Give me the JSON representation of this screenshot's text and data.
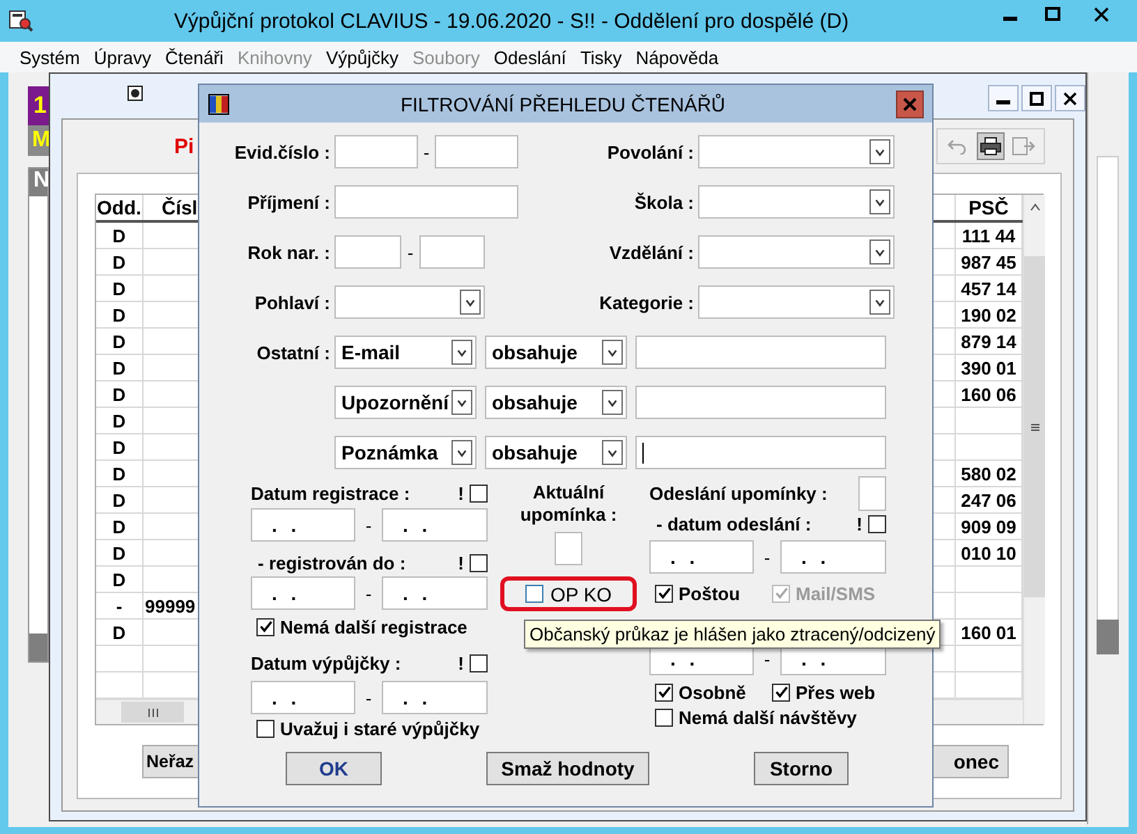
{
  "window": {
    "title": "Výpůjční protokol CLAVIUS - 19.06.2020 - S!! - Oddělení pro dospělé (D)"
  },
  "menu": [
    {
      "label": "Systém",
      "disabled": false
    },
    {
      "label": "Úpravy",
      "disabled": false
    },
    {
      "label": "Čtenáři",
      "disabled": false
    },
    {
      "label": "Knihovny",
      "disabled": true
    },
    {
      "label": "Výpůjčky",
      "disabled": false
    },
    {
      "label": "Soubory",
      "disabled": true
    },
    {
      "label": "Odeslání",
      "disabled": false
    },
    {
      "label": "Tisky",
      "disabled": false
    },
    {
      "label": "Nápověda",
      "disabled": false
    }
  ],
  "side_window": {
    "badge": "1",
    "label": "M",
    "column_1": "N"
  },
  "list_window": {
    "heading": "Pi",
    "toolbar": [
      {
        "kind": "undo",
        "disabled": true
      },
      {
        "kind": "print",
        "disabled": false
      },
      {
        "kind": "export",
        "disabled": true
      }
    ],
    "table": {
      "columns": [
        "Odd.",
        "Čísl",
        "PSČ"
      ],
      "rows": [
        {
          "odd": "D",
          "psc": "111 44"
        },
        {
          "odd": "D",
          "psc": "987 45"
        },
        {
          "odd": "D",
          "psc": "457 14"
        },
        {
          "odd": "D",
          "psc": "190 02"
        },
        {
          "odd": "D",
          "psc": "879 14"
        },
        {
          "odd": "D",
          "psc": "390 01"
        },
        {
          "odd": "D",
          "psc": "160 06"
        },
        {
          "odd": "D"
        },
        {
          "odd": "D"
        },
        {
          "odd": "D",
          "psc": "580 02"
        },
        {
          "odd": "D",
          "psc": "247 06"
        },
        {
          "odd": "D",
          "psc": "909 09"
        },
        {
          "odd": "D",
          "psc": "010 10"
        },
        {
          "odd": "D"
        },
        {
          "odd": "-",
          "cislo": "99999"
        },
        {
          "odd": "D",
          "psc": "160 01"
        }
      ]
    },
    "buttons": [
      "Neřaz",
      "onec"
    ]
  },
  "dialog": {
    "title": "FILTROVÁNÍ PŘEHLEDU ČTENÁŘŮ",
    "evid_cislo": {
      "label": "Evid.číslo :",
      "separator": "-"
    },
    "prijmeni": {
      "label": "Příjmení :"
    },
    "rok_nar": {
      "label": "Rok nar. :",
      "separator": "-"
    },
    "pohlavi": {
      "label": "Pohlaví :"
    },
    "right_dropdowns": [
      {
        "label": "Povolání :"
      },
      {
        "label": "Škola :"
      },
      {
        "label": "Vzdělání :"
      },
      {
        "label": "Kategorie :"
      }
    ],
    "ostatni": {
      "label": "Ostatní :",
      "rows": [
        {
          "field": "E-mail",
          "operator": "obsahuje",
          "focused": false
        },
        {
          "field": "Upozornění",
          "operator": "obsahuje",
          "focused": false
        },
        {
          "field": "Poznámka",
          "operator": "obsahuje",
          "focused": true
        }
      ]
    },
    "datum_registrace": {
      "label": "Datum registrace :",
      "flag": "!",
      "flag_checked": false,
      "from": ". .",
      "separator": "-",
      "to": ". ."
    },
    "registrovan_do": {
      "label": "- registrován do :",
      "flag": "!",
      "flag_checked": false,
      "from": ". .",
      "separator": "-",
      "to": ". ."
    },
    "nema_dalsi_registrace": {
      "label": "Nemá další registrace",
      "checked": true
    },
    "datum_vypujcky": {
      "label": "Datum výpůjčky :",
      "flag": "!",
      "flag_checked": false,
      "from": ". .",
      "separator": "-",
      "to": ". ."
    },
    "uvazuj_stare": {
      "label": "Uvažuj i staré výpůjčky",
      "checked": false
    },
    "aktualni_upominka": {
      "label": "Aktuální upomínka :"
    },
    "op_ko": {
      "label": "OP KO",
      "checked": false,
      "highlighted": true
    },
    "odeslani_upominky": {
      "label": "Odeslání upomínky :"
    },
    "datum_odeslani": {
      "label": "- datum odeslání :",
      "flag": "!",
      "flag_checked": false,
      "from": ". .",
      "separator": "-",
      "to": ". ."
    },
    "channels": [
      {
        "label": "Poštou",
        "checked": true,
        "disabled": false
      },
      {
        "label": "Mail/SMS",
        "checked": true,
        "disabled": true
      }
    ],
    "second_range": {
      "from": ". .",
      "separator": "-",
      "to": ". ."
    },
    "visits": [
      {
        "label": "Osobně",
        "checked": true
      },
      {
        "label": "Přes web",
        "checked": true
      }
    ],
    "nema_dalsi_navstevy": {
      "label": "Nemá další návštěvy",
      "checked": false
    },
    "buttons": [
      {
        "label": "OK",
        "focused": true
      },
      {
        "label": "Smaž hodnoty",
        "focused": false
      },
      {
        "label": "Storno",
        "focused": false
      }
    ]
  },
  "tooltip": "Občanský průkaz je hlášen jako ztracený/odcizený"
}
